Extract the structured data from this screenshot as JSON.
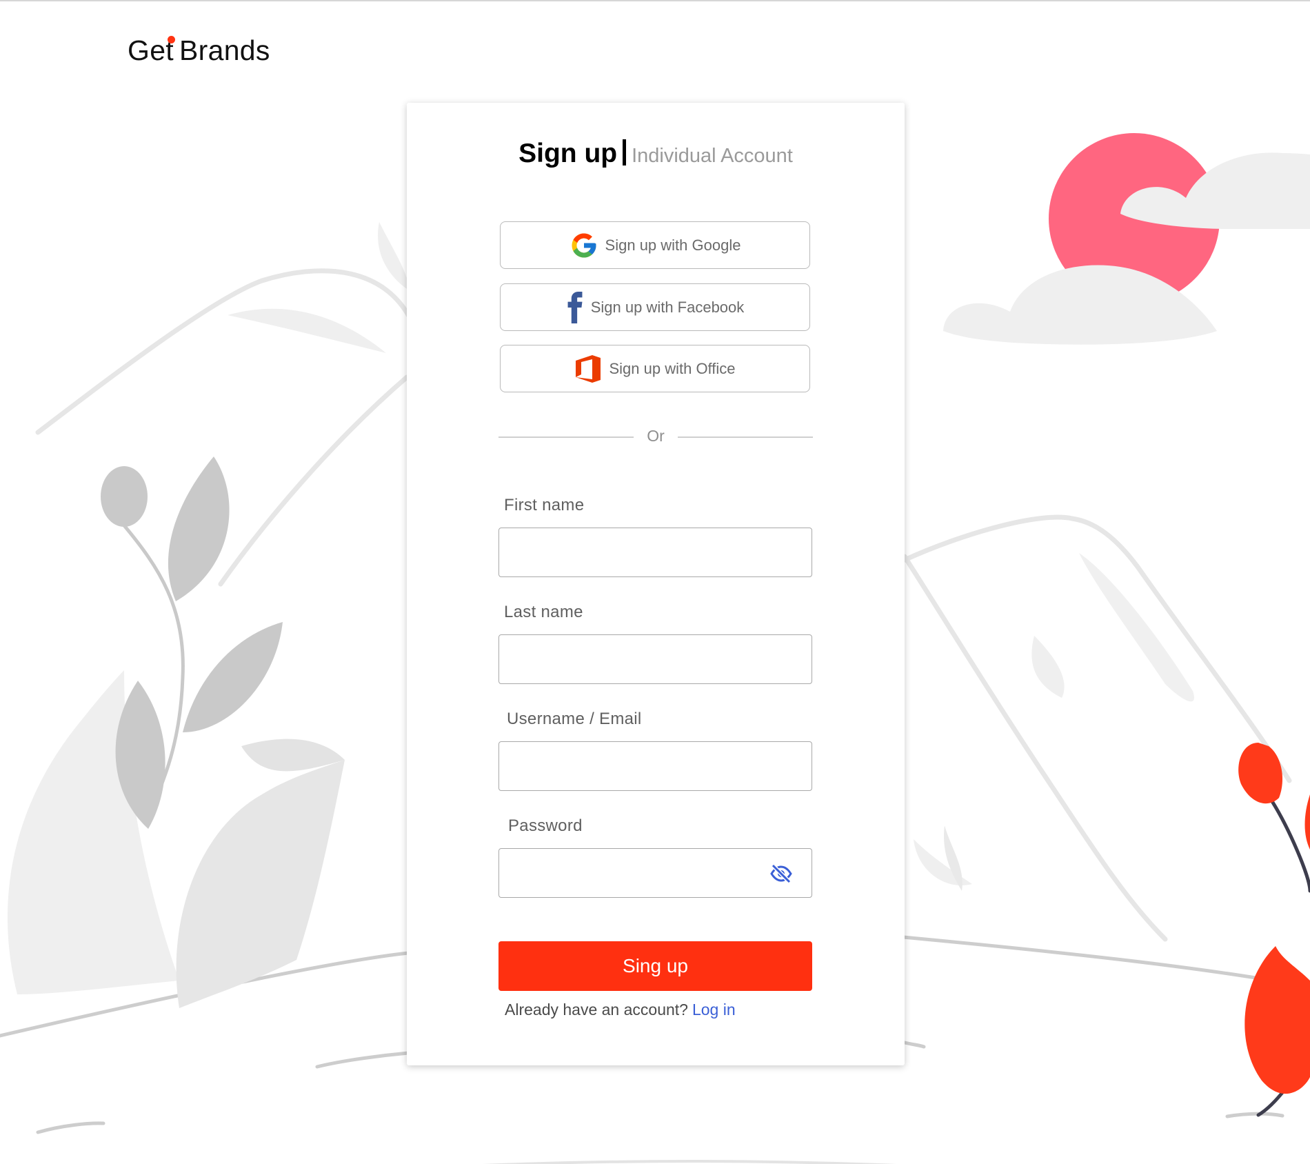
{
  "brand": {
    "name_part1": "Get",
    "name_part2": "Brands",
    "dot_color": "#ff3311"
  },
  "card": {
    "title": "Sign up",
    "subtitle": "Individual Account"
  },
  "social": {
    "google_label": "Sign up with Google",
    "facebook_label": "Sign up with Facebook",
    "office_label": "Sign up with Office"
  },
  "divider": {
    "text": "Or"
  },
  "form": {
    "first_name_label": "First name",
    "first_name_value": "",
    "last_name_label": "Last name",
    "last_name_value": "",
    "username_label": "Username / Email",
    "username_value": "",
    "password_label": "Password",
    "password_value": "",
    "password_toggle_icon": "eye-slash-icon",
    "submit_label": "Sing up"
  },
  "footer": {
    "prompt": "Already have an account?",
    "login_link": "Log in"
  },
  "colors": {
    "accent": "#ff3010",
    "link": "#3a5fd6",
    "sun": "#ff6680"
  }
}
